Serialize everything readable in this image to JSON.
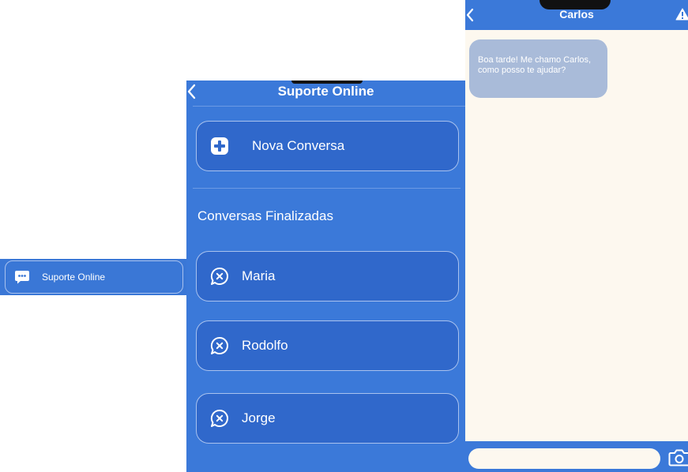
{
  "menu_entry": {
    "icon": "chat-dots-icon",
    "label": "Suporte Online"
  },
  "support": {
    "title": "Suporte Online",
    "new_chat": {
      "icon": "plus-square-icon",
      "label": "Nova Conversa"
    },
    "finished_section": "Conversas Finalizadas",
    "finished_chats": [
      {
        "name": "Maria",
        "icon": "closed-chat-icon"
      },
      {
        "name": "Rodolfo",
        "icon": "closed-chat-icon"
      },
      {
        "name": "Jorge",
        "icon": "closed-chat-icon"
      }
    ]
  },
  "chat": {
    "title": "Carlos",
    "messages": [
      {
        "text": "Boa tarde! Me chamo Carlos, como posso te ajudar?"
      }
    ],
    "input": {
      "value": "",
      "placeholder": ""
    },
    "icons": {
      "back": "chevron-left-icon",
      "report": "warning-icon",
      "attach": "camera-icon"
    }
  },
  "colors": {
    "primary": "#3b79d9",
    "card": "#3068cb",
    "chat_background": "#fdf8ef",
    "bubble": "#a9bbd9"
  }
}
